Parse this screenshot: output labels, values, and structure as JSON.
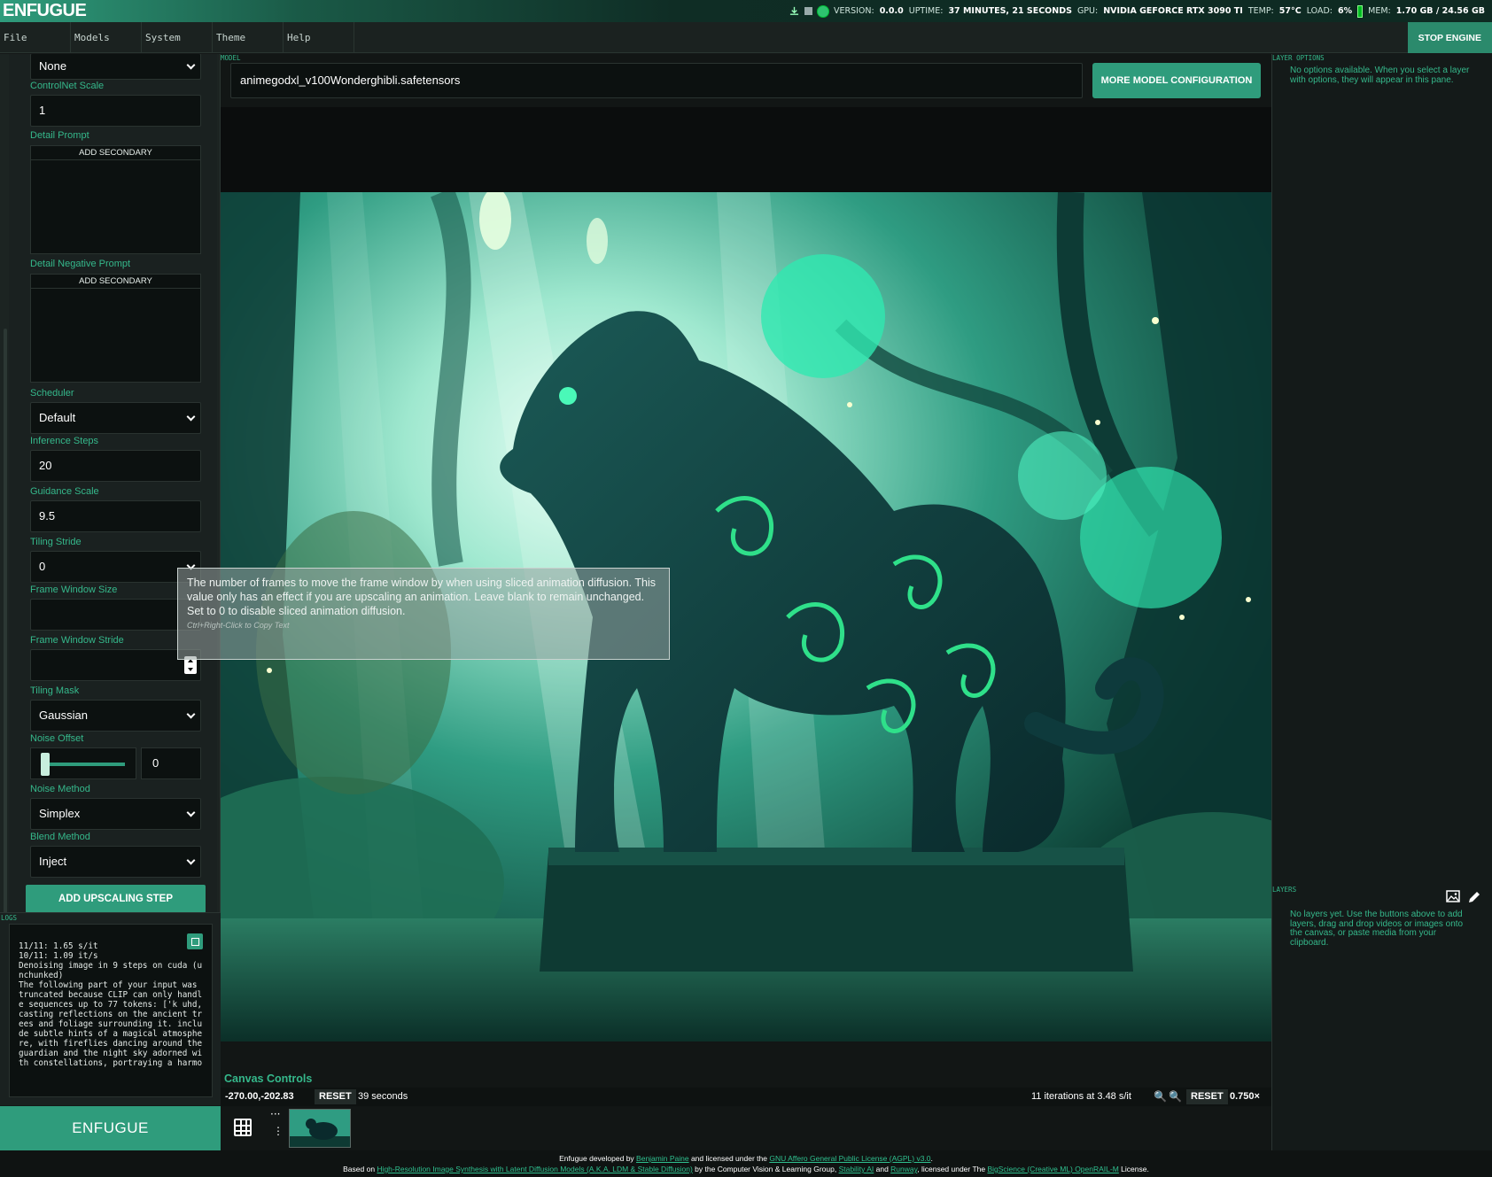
{
  "titlebar": {
    "brand": "ENFUGUE",
    "version_label": "VERSION:",
    "version": "0.0.0",
    "uptime_label": "UPTIME:",
    "uptime": "37 MINUTES, 21 SECONDS",
    "gpu_label": "GPU:",
    "gpu": "NVIDIA GEFORCE RTX 3090 TI",
    "temp_label": "TEMP:",
    "temp": "57°C",
    "load_label": "LOAD:",
    "load": "6%",
    "mem_label": "MEM:",
    "mem": "1.70 GB / 24.56 GB"
  },
  "menu": {
    "items": [
      "File",
      "Models",
      "System",
      "Theme",
      "Help"
    ],
    "stop_engine": "STOP ENGINE"
  },
  "sidebar": {
    "top_select": "None",
    "controlnet_scale_label": "ControlNet Scale",
    "controlnet_scale": "1",
    "detail_prompt_label": "Detail Prompt",
    "add_secondary": "ADD SECONDARY",
    "detail_negative_label": "Detail Negative Prompt",
    "add_secondary_2": "ADD SECONDARY",
    "scheduler_label": "Scheduler",
    "scheduler": "Default",
    "inference_steps_label": "Inference Steps",
    "inference_steps": "20",
    "guidance_scale_label": "Guidance Scale",
    "guidance_scale": "9.5",
    "tiling_stride_label": "Tiling Stride",
    "tiling_stride": "0",
    "frame_window_size_label": "Frame Window Size",
    "frame_window_stride_label": "Frame Window Stride",
    "tiling_mask_label": "Tiling Mask",
    "tiling_mask": "Gaussian",
    "noise_offset_label": "Noise Offset",
    "noise_offset": "0",
    "noise_method_label": "Noise Method",
    "noise_method": "Simplex",
    "blend_method_label": "Blend Method",
    "blend_method": "Inject",
    "add_upscaling": "ADD UPSCALING STEP"
  },
  "logs": {
    "label": "LOGS",
    "text": "11/11: 1.65 s/it\n10/11: 1.09 it/s\nDenoising image in 9 steps on cuda (u\nnchunked)\nThe following part of your input was\ntruncated because CLIP can only handl\ne sequences up to 77 tokens: ['k uhd,\ncasting reflections on the ancient tr\nees and foliage surrounding it. inclu\nde subtle hints of a magical atmosphe\nre, with fireflies dancing around the\nguardian and the night sky adorned wi\nth constellations, portraying a harmo"
  },
  "main": {
    "model_label": "MODEL",
    "model": "animegodxl_v100Wonderghibli.safetensors",
    "more_config": "MORE MODEL CONFIGURATION"
  },
  "tooltip": {
    "text": "The number of frames to move the frame window by when using sliced animation diffusion. This value only has an effect if you are upscaling an animation. Leave blank to remain unchanged. Set to 0 to disable sliced animation diffusion.",
    "hint": "Ctrl+Right-Click to Copy Text"
  },
  "canvas_controls": {
    "title": "Canvas Controls",
    "coords": "-270.00,-202.83",
    "reset": "RESET",
    "time": "39 seconds",
    "iterations": "11 iterations at 3.48 s/it",
    "reset2": "RESET",
    "zoom": "0.750×"
  },
  "right": {
    "layer_options_label": "LAYER OPTIONS",
    "layer_options_text": "No options available. When you select a layer with options, they will appear in this pane.",
    "layers_label": "LAYERS",
    "layers_text": "No layers yet. Use the buttons above to add layers, drag and drop videos or images onto the canvas, or paste media from your clipboard."
  },
  "bottom": {
    "enfugue_button": "ENFUGUE",
    "dots_h": "···",
    "dots_v": "⋮"
  },
  "footer": {
    "line1_a": "Enfugue developed by ",
    "author": "Benjamin Paine",
    "line1_b": " and licensed under the ",
    "license": "GNU Affero General Public License (AGPL) v3.0",
    "line1_c": ".",
    "line2_a": "Based on ",
    "paper": "High-Resolution Image Synthesis with Latent Diffusion Models (A.K.A. LDM & Stable Diffusion)",
    "line2_b": " by the Computer Vision & Learning Group, ",
    "stability": "Stability AI",
    "line2_c": " and ",
    "runway": "Runway",
    "line2_d": ", licensed under The ",
    "openrail": "BigScience (Creative ML) OpenRAIL-M",
    "line2_e": " License."
  }
}
